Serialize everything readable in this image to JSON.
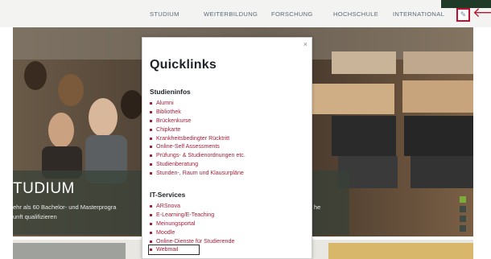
{
  "nav": {
    "items": [
      "STUDIUM",
      "WEITERBILDUNG",
      "FORSCHUNG",
      "HOCHSCHULE",
      "INTERNATIONAL"
    ],
    "quicklinks_icon": "link-icon",
    "quicklinks_glyph": "✎",
    "pointer_glyph": "🡐"
  },
  "hero": {
    "title": "TUDIUM",
    "text_line1": "ehr als 60 Bachelor- und Masterprogra",
    "text_line2": "unft qualifizieren",
    "text_right": "he",
    "slides": {
      "count": 4,
      "active": 0
    }
  },
  "quicklinks": {
    "title": "Quicklinks",
    "close_glyph": "×",
    "sections": [
      {
        "heading": "Studieninfos",
        "links": [
          "Alumni",
          "Bibliothek",
          "Brückenkurse",
          "Chipkarte",
          "Krankheitsbedingter Rücktritt",
          "Online-Self Assessments",
          "Prüfungs- & Studienordnungen etc.",
          "Studienberatung",
          "Stunden-, Raum und Klausurpläne"
        ]
      },
      {
        "heading": "IT-Services",
        "links": [
          "ARSnova",
          "E-Learning/E-Teaching",
          "Meinungsportal",
          "Moodle",
          "Online-Dienste für Studierende",
          "Webmail"
        ]
      }
    ],
    "highlighted_link": "Webmail"
  },
  "colors": {
    "accent": "#c10f2f",
    "link": "#a4213a",
    "nav_text": "#5b6a78",
    "slide_active": "#7dab39"
  }
}
